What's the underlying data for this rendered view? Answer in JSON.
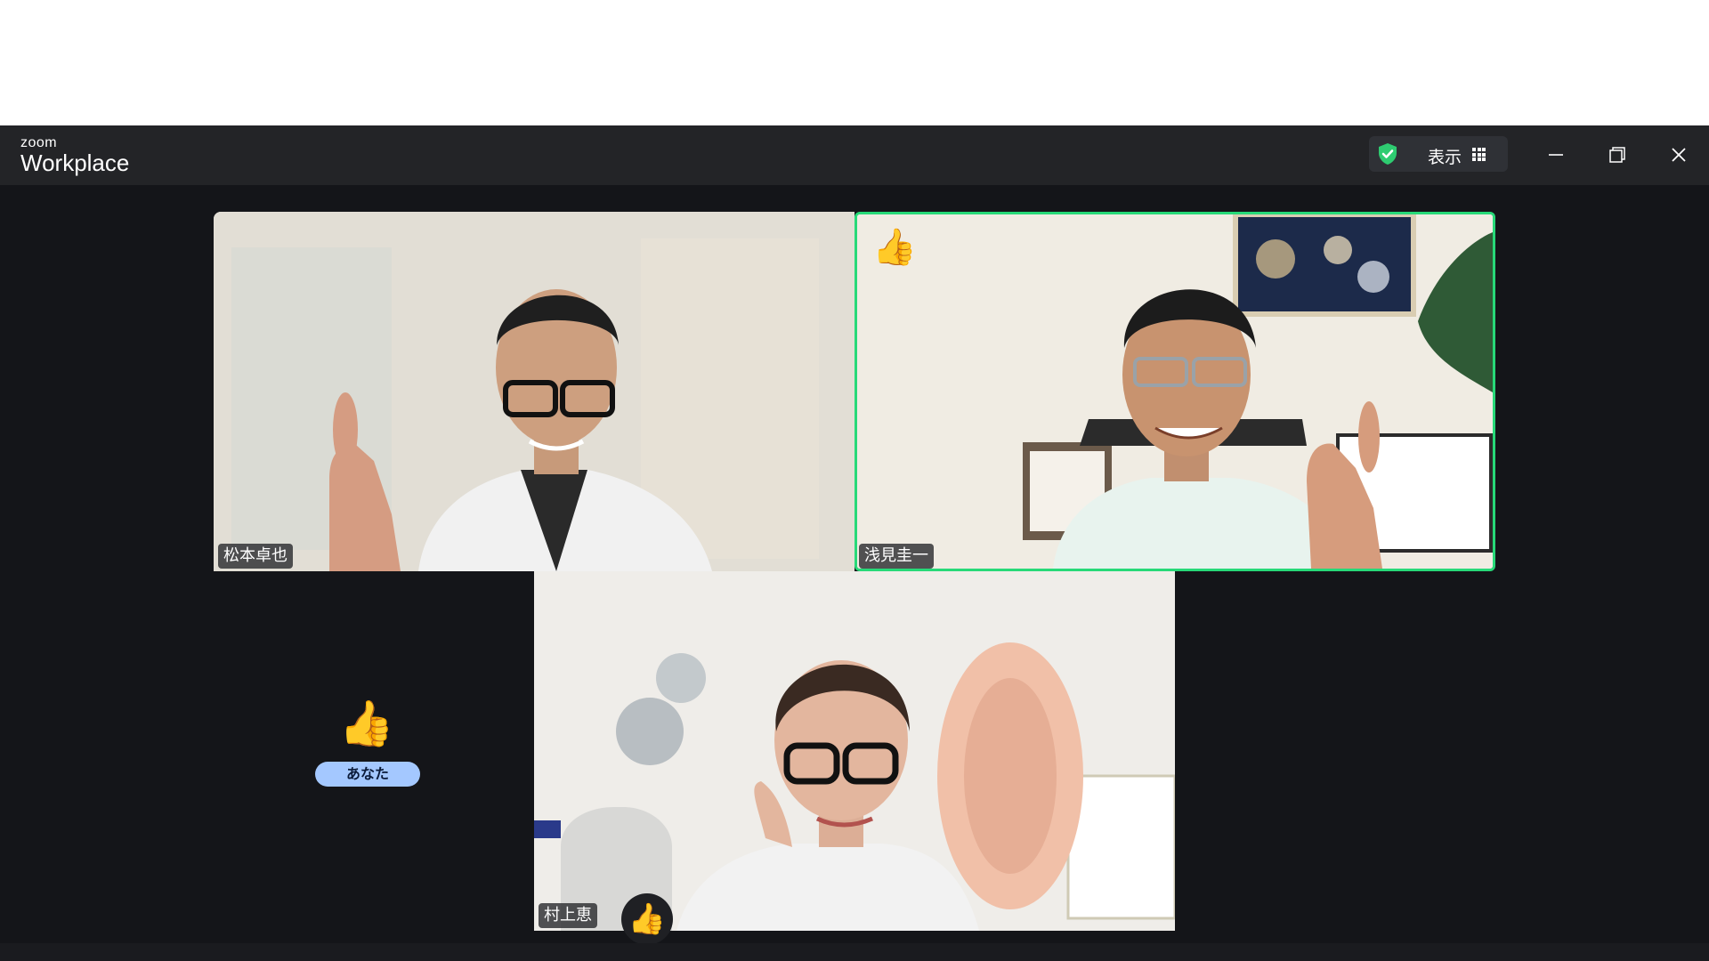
{
  "titlebar": {
    "brand_small": "zoom",
    "brand_big": "Workplace",
    "view_label": "表示"
  },
  "participants": [
    {
      "name": "松本卓也",
      "reaction": ""
    },
    {
      "name": "浅見圭一",
      "reaction": "👍",
      "active_speaker": true
    },
    {
      "name": "村上恵",
      "reaction": ""
    }
  ],
  "self": {
    "label": "あなた",
    "reaction": "👍"
  },
  "floating_reaction": "👍",
  "colors": {
    "titlebar_bg": "#232427",
    "stage_bg": "#141519",
    "active_border": "#27d978",
    "shield": "#2ecc71",
    "you_badge": "#a4c8ff"
  },
  "icons": [
    "shield-check-icon",
    "grid-icon",
    "minimize-icon",
    "restore-icon",
    "close-icon",
    "thumbs-up-icon"
  ]
}
